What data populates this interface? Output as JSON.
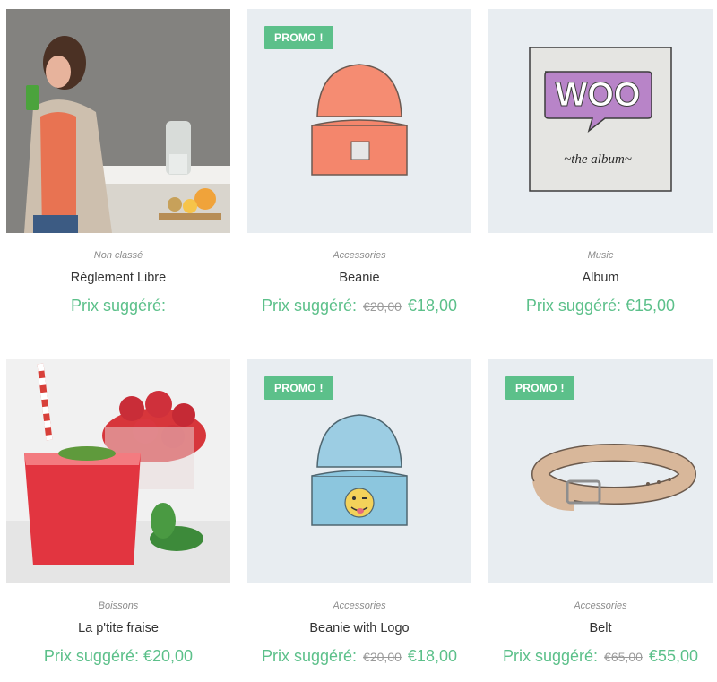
{
  "colors": {
    "accent": "#5cc08a",
    "thumb_bg": "#e8edf1"
  },
  "products": [
    {
      "category": "Non classé",
      "title": "Règlement Libre",
      "price_label": "Prix suggéré:",
      "old_price": "",
      "price": "",
      "badge": "",
      "image": "woman-juice-photo"
    },
    {
      "category": "Accessories",
      "title": "Beanie",
      "price_label": "Prix suggéré:",
      "old_price": "€20,00",
      "price": "€18,00",
      "badge": "PROMO !",
      "image": "orange-beanie"
    },
    {
      "category": "Music",
      "title": "Album",
      "price_label": "Prix suggéré:",
      "old_price": "",
      "price": "€15,00",
      "badge": "",
      "image": "woo-album-cover"
    },
    {
      "category": "Boissons",
      "title": "La p'tite fraise",
      "price_label": "Prix suggéré:",
      "old_price": "",
      "price": "€20,00",
      "badge": "",
      "image": "strawberry-drink-photo"
    },
    {
      "category": "Accessories",
      "title": "Beanie with Logo",
      "price_label": "Prix suggéré:",
      "old_price": "€20,00",
      "price": "€18,00",
      "badge": "PROMO !",
      "image": "blue-beanie-logo"
    },
    {
      "category": "Accessories",
      "title": "Belt",
      "price_label": "Prix suggéré:",
      "old_price": "€65,00",
      "price": "€55,00",
      "badge": "PROMO !",
      "image": "leather-belt"
    }
  ],
  "album_art": {
    "logo": "WOO",
    "caption": "~the album~"
  }
}
